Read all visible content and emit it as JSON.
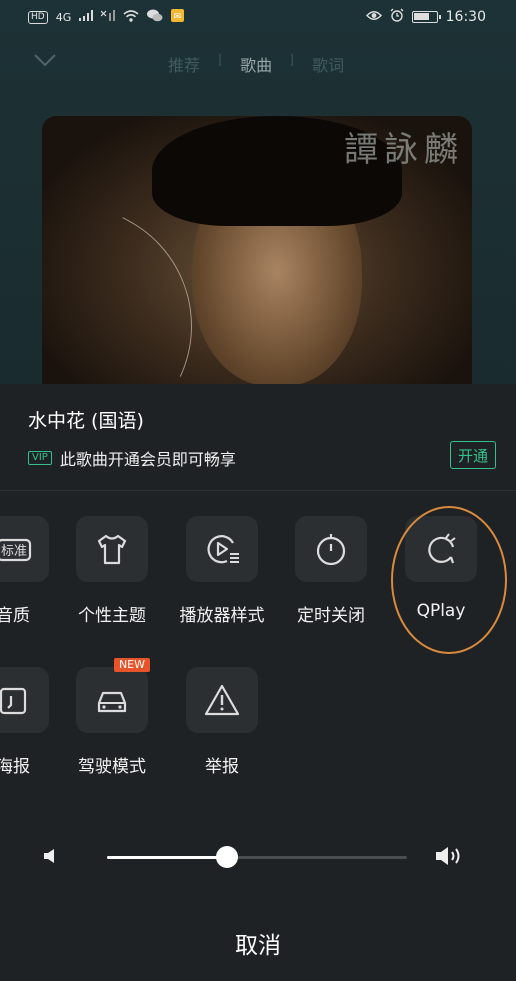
{
  "status_bar": {
    "left_icons": [
      "HD",
      "4G",
      "signal-icon",
      "no-signal-icon",
      "wifi-icon",
      "wechat-icon",
      "notification-icon"
    ],
    "hd_label": "HD",
    "network_label": "4G",
    "time": "16:30",
    "battery_level": 0.75
  },
  "player": {
    "tabs": [
      {
        "label": "推荐",
        "active": false
      },
      {
        "label": "歌曲",
        "active": true
      },
      {
        "label": "歌词",
        "active": false
      }
    ],
    "album_art_text": "譚詠麟"
  },
  "sheet": {
    "song_title": "水中花 (国语)",
    "vip_badge": "VIP",
    "vip_message": "此歌曲开通会员即可畅享",
    "open_button": "开通",
    "row1": [
      {
        "label": "音质",
        "icon": "quality-icon",
        "icon_text": "标准"
      },
      {
        "label": "个性主题",
        "icon": "tshirt-icon"
      },
      {
        "label": "播放器样式",
        "icon": "player-style-icon"
      },
      {
        "label": "定时关闭",
        "icon": "timer-icon"
      },
      {
        "label": "QPlay",
        "icon": "qplay-icon",
        "highlighted": true
      }
    ],
    "row2": [
      {
        "label": "海报",
        "icon": "poster-icon"
      },
      {
        "label": "驾驶模式",
        "icon": "car-icon",
        "badge": "NEW"
      },
      {
        "label": "举报",
        "icon": "warning-icon"
      }
    ],
    "volume": {
      "level": 0.4
    },
    "cancel_button": "取消"
  },
  "colors": {
    "accent_green": "#33c08a",
    "new_badge": "#e8542a",
    "highlight_ring": "#d98a3d",
    "sheet_bg": "#1f2224"
  }
}
